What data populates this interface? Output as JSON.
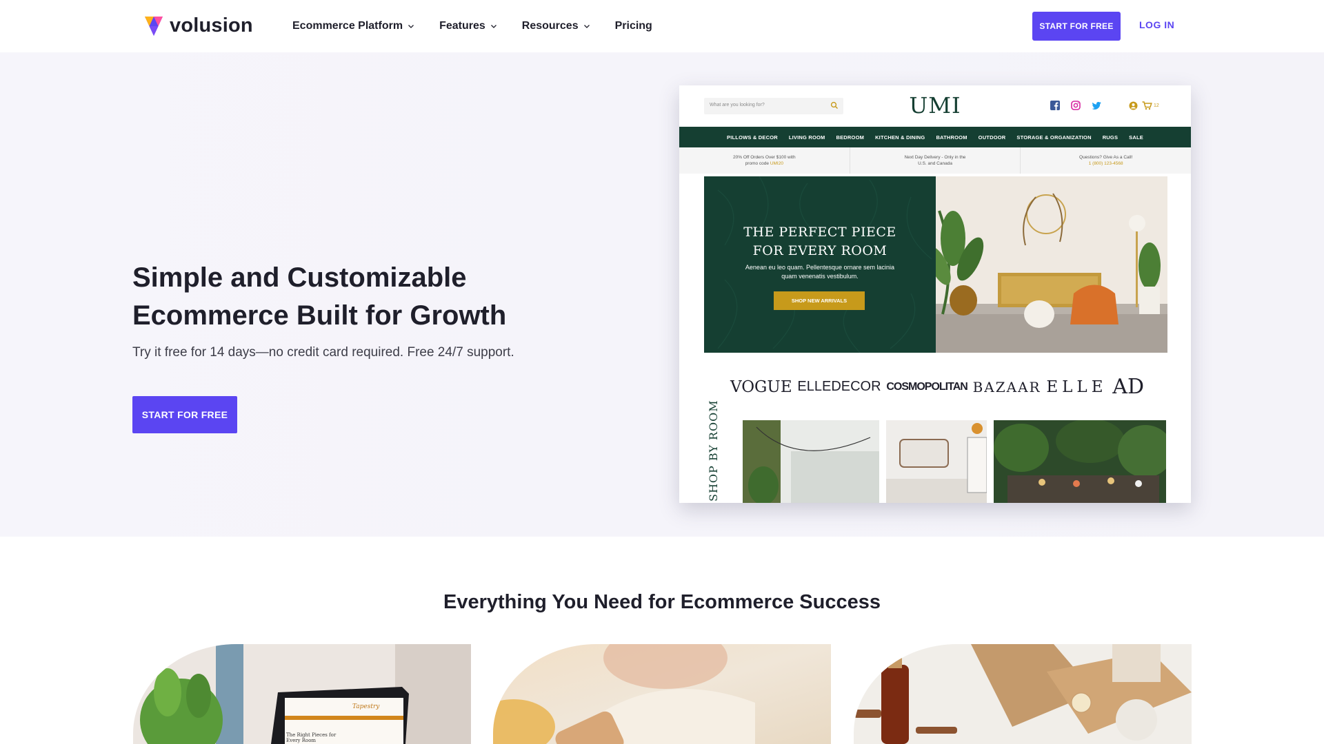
{
  "header": {
    "logo_text": "volusion",
    "nav": [
      "Ecommerce Platform",
      "Features",
      "Resources",
      "Pricing"
    ],
    "start_button": "START FOR FREE",
    "login": "LOG IN",
    "colors": {
      "brand": "#5b45f2",
      "text": "#1f1f2b"
    }
  },
  "hero": {
    "title": "Simple and Customizable Ecommerce Built for Growth",
    "subtitle": "Try it free for 14 days—no credit card required. Free 24/7 support.",
    "cta": "START FOR FREE"
  },
  "preview": {
    "search_placeholder": "What are you looking for?",
    "store_name": "UMI",
    "cart_count": "12",
    "nav": [
      "PILLOWS & DECOR",
      "LIVING ROOM",
      "BEDROOM",
      "KITCHEN & DINING",
      "BATHROOM",
      "OUTDOOR",
      "STORAGE & ORGANIZATION",
      "RUGS",
      "SALE"
    ],
    "promos": [
      {
        "line1": "20% Off Orders Over $100 with",
        "line2": "promo code",
        "highlight": "UMI20"
      },
      {
        "line1": "Next Day Delivery - Only in the",
        "line2": "U.S. and Canada",
        "highlight": ""
      },
      {
        "line1": "Questions? Give As a Call!",
        "line2": "",
        "highlight": "1 (800) 123-4568"
      }
    ],
    "banner_title_1": "THE PERFECT PIECE",
    "banner_title_2": "FOR EVERY ROOM",
    "banner_sub": "Aenean eu leo quam. Pellentesque ornare sem lacinia quam venenatis vestibulum.",
    "banner_button": "SHOP NEW ARRIVALS",
    "press": [
      "VOGUE",
      "ELLEDECOR",
      "COSMOPOLITAN",
      "BAZAAR",
      "ELLE",
      "AD"
    ],
    "shop_by": "SHOP BY ROOM",
    "colors": {
      "green": "#153f32",
      "gold": "#c79a1b"
    }
  },
  "features": {
    "title": "Everything You Need for Ecommerce Success",
    "card1_site_name": "Tapestry",
    "card1_site_tagline": "The Right Pieces for Every Room"
  }
}
